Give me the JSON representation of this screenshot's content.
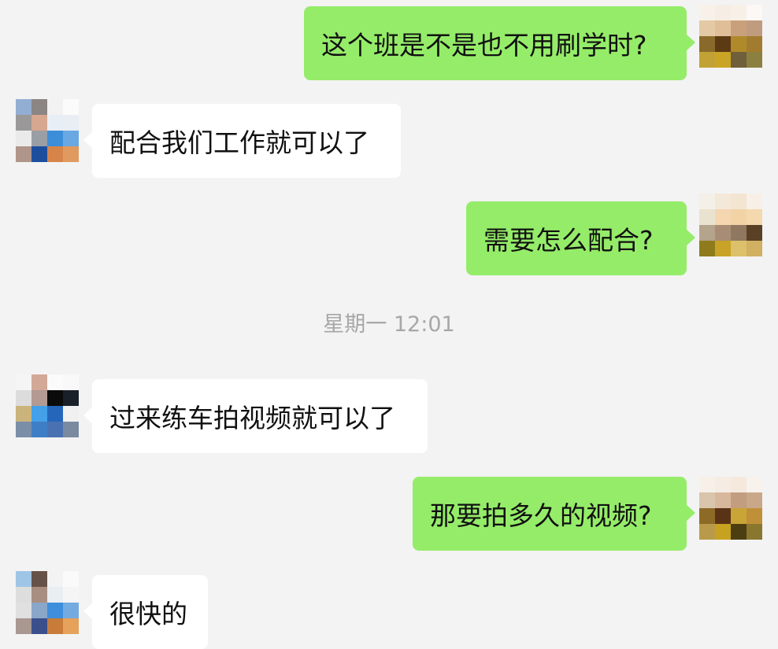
{
  "messages": [
    {
      "from": "me",
      "text": "这个班是不是也不用刷学时?"
    },
    {
      "from": "them",
      "text": "配合我们工作就可以了"
    },
    {
      "from": "me",
      "text": "需要怎么配合?"
    },
    {
      "from": "them",
      "text": "过来练车拍视频就可以了"
    },
    {
      "from": "me",
      "text": "那要拍多久的视频?"
    },
    {
      "from": "them",
      "text": "很快的"
    }
  ],
  "timestamp": "星期一 12:01",
  "colors": {
    "background": "#f3f3f3",
    "my_bubble": "#95ec69",
    "their_bubble": "#ffffff",
    "timestamp": "#a7a7a7"
  },
  "avatars": {
    "me_1": [
      "#f7f1ea",
      "#f6eee4",
      "#f7f0e7",
      "#fbf8f5",
      "#e3c9a4",
      "#e0be98",
      "#c9a07c",
      "#c09c7e",
      "#8a6a2a",
      "#5b3a14",
      "#b08a2a",
      "#a27c2e",
      "#c3a235",
      "#caa525",
      "#6f5f3a",
      "#8c8040"
    ],
    "them_1": [
      "#93aed3",
      "#8b8584",
      "#f2f2f2",
      "#fbfbfb",
      "#9a9898",
      "#d7a78f",
      "#e8eef5",
      "#e9eef4",
      "#eaeaea",
      "#9a9fa6",
      "#3d8ed9",
      "#6aa8e3",
      "#b0958a",
      "#1d4e9e",
      "#d6844a",
      "#e19a5e"
    ],
    "me_2": [
      "#f4efe7",
      "#f4e8d8",
      "#f3e5d1",
      "#f8f0e6",
      "#e8e2cf",
      "#f4d6b0",
      "#f2d3a6",
      "#f4d8ae",
      "#b4a48c",
      "#a88d74",
      "#8f785f",
      "#5a4025",
      "#8e7c1c",
      "#c8a327",
      "#dcc06a",
      "#d2b061"
    ],
    "them_2": [
      "#f5f5f5",
      "#d2a896",
      "#fbfbfb",
      "#f9f9f9",
      "#dcdcdc",
      "#b39a93",
      "#0b0b0b",
      "#19202a",
      "#cab47c",
      "#44a0e8",
      "#2566bb",
      "#f0f0f0",
      "#7a8ea8",
      "#3e7ec5",
      "#4a72b3",
      "#7a8aa0"
    ],
    "me_3": [
      "#f7f0e8",
      "#f5ece3",
      "#f5e9de",
      "#f8f2ec",
      "#d9c4ac",
      "#d8b89c",
      "#c39d80",
      "#c9a889",
      "#8d6a26",
      "#5a3216",
      "#c9a437",
      "#c09038",
      "#b89a4a",
      "#c7a220",
      "#4d3e12",
      "#897730"
    ],
    "them_3": [
      "#9fc5e6",
      "#675249",
      "#f3f3f3",
      "#fafafa",
      "#dddddd",
      "#a88e80",
      "#e9eef3",
      "#f5f5f5",
      "#e0e0e0",
      "#8aa6c8",
      "#3f8edc",
      "#73abe0",
      "#a89891",
      "#3a4f8c",
      "#c77c3a",
      "#e6a15a"
    ]
  }
}
